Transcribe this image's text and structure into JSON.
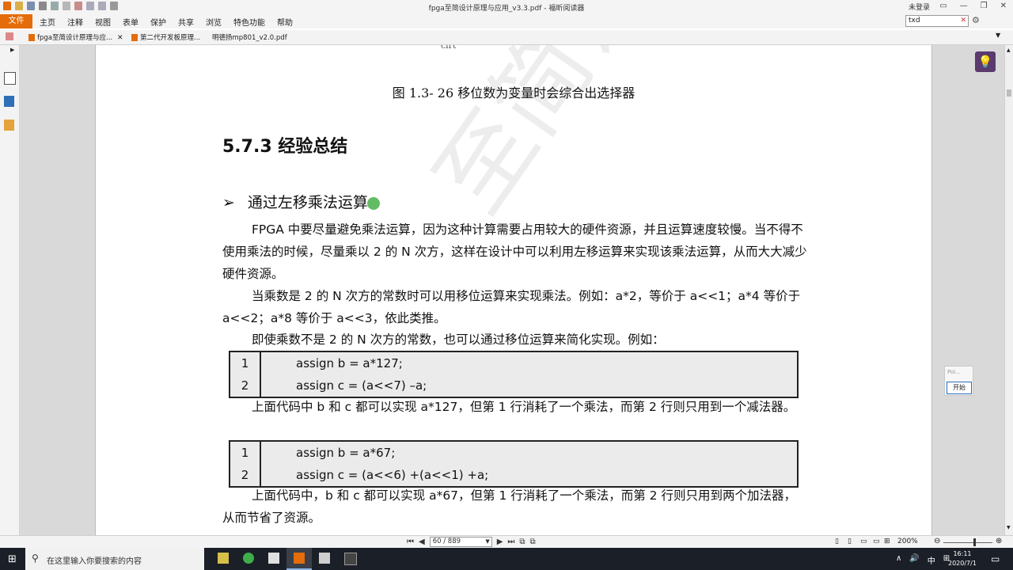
{
  "window": {
    "title": "fpga至简设计原理与应用_v3.3.pdf - 福昕阅读器",
    "login_label": "未登录",
    "controls": [
      "▭",
      "—",
      "❐",
      "✕"
    ]
  },
  "menu": {
    "file_label": "文件",
    "items": [
      "主页",
      "注释",
      "视图",
      "表单",
      "保护",
      "共享",
      "浏览",
      "特色功能",
      "帮助"
    ],
    "search_value": "txd"
  },
  "tabs": [
    {
      "label": "fpga至简设计原理与应..."
    },
    {
      "label": "第二代开发板原理..."
    },
    {
      "label": "明德扬mp801_v2.0.pdf"
    }
  ],
  "document": {
    "cut_text": "clrt",
    "figure_caption": "图 1.3-  26 移位数为变量时会综合出选择器",
    "section_heading": "5.7.3  经验总结",
    "bullet_heading": "通过左移乘法运算",
    "paragraph1": "FPGA 中要尽量避免乘法运算，因为这种计算需要占用较大的硬件资源，并且运算速度较慢。当不得不使用乘法的时候，尽量乘以 2 的 N 次方，这样在设计中可以利用左移运算来实现该乘法运算，从而大大减少硬件资源。",
    "paragraph2": "当乘数是 2 的 N 次方的常数时可以用移位运算来实现乘法。例如：a*2，等价于  a<<1；a*4 等价于 a<<2；a*8 等价于 a<<3，依此类推。",
    "paragraph3": "即使乘数不是 2 的 N 次方的常数，也可以通过移位运算来简化实现。例如：",
    "code1": [
      {
        "line": "1",
        "code": "assign  b  =  a*127;"
      },
      {
        "line": "2",
        "code": "assign  c  =  (a<<7)  –a;"
      }
    ],
    "paragraph4": "上面代码中 b 和 c 都可以实现 a*127，但第 1 行消耗了一个乘法，而第 2 行则只用到一个减法器。",
    "code2": [
      {
        "line": "1",
        "code": "assign  b  =  a*67;"
      },
      {
        "line": "2",
        "code": "assign  c  =  (a<<6)  +(a<<1)  +a;"
      }
    ],
    "paragraph5": "上面代码中，b 和 c 都可以实现 a*67，但第 1 行消耗了一个乘法，而第 2 行则只用到两个加法器，从而节省了资源。",
    "watermark": "至简设计原理与应"
  },
  "popup": {
    "title": "Poi...",
    "button": "开始"
  },
  "status": {
    "page_indicator": "60 / 889",
    "zoom": "200%"
  },
  "taskbar": {
    "search_placeholder": "在这里输入你要搜索的内容",
    "tray": [
      "∧",
      "🔊",
      "中",
      "⊞"
    ],
    "time": "16:11",
    "date": "2020/7/1"
  },
  "colors": {
    "accent_orange": "#e46c0a",
    "taskbar": "#1b1f27",
    "code_bg": "#ebebeb"
  }
}
